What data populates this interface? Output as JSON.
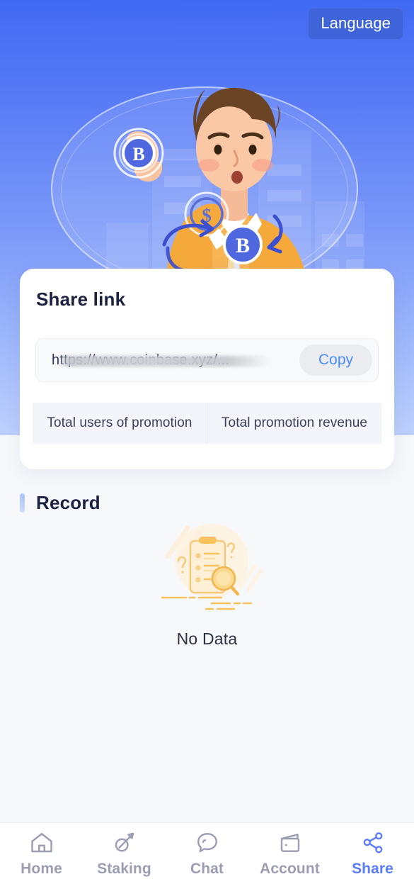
{
  "header": {
    "language_button": "Language"
  },
  "hero": {
    "illustration_name": "crypto-exchange-character-illustration"
  },
  "share_card": {
    "title": "Share link",
    "link_value": "https://www.coinbase.xyz/...",
    "link_redacted": true,
    "copy_label": "Copy",
    "stats": [
      {
        "label": "Total users of promotion",
        "value": ""
      },
      {
        "label": "Total promotion revenue",
        "value": ""
      }
    ]
  },
  "record": {
    "title": "Record",
    "empty_text": "No Data",
    "empty_illustration": "clipboard-magnifier-no-data-icon"
  },
  "tabbar": {
    "items": [
      {
        "label": "Home",
        "icon": "home-icon",
        "active": false
      },
      {
        "label": "Staking",
        "icon": "pickaxe-icon",
        "active": false
      },
      {
        "label": "Chat",
        "icon": "chat-bubble-icon",
        "active": false
      },
      {
        "label": "Account",
        "icon": "wallet-icon",
        "active": false
      },
      {
        "label": "Share",
        "icon": "share-nodes-icon",
        "active": true
      }
    ]
  },
  "colors": {
    "hero_gradient_top": "#4169f2",
    "hero_gradient_bottom": "#bed0fc",
    "accent_blue": "#5b7cfa",
    "copy_link_blue": "#4a8cf7",
    "language_btn_bg": "#3f63d9",
    "page_bg": "#f7f8fa",
    "card_bg": "#ffffff",
    "stats_bg": "#f4f5fa",
    "heading_navy": "#1b2240",
    "tab_inactive": "#9b9eb3",
    "empty_art_amber": "#f5b84f"
  }
}
